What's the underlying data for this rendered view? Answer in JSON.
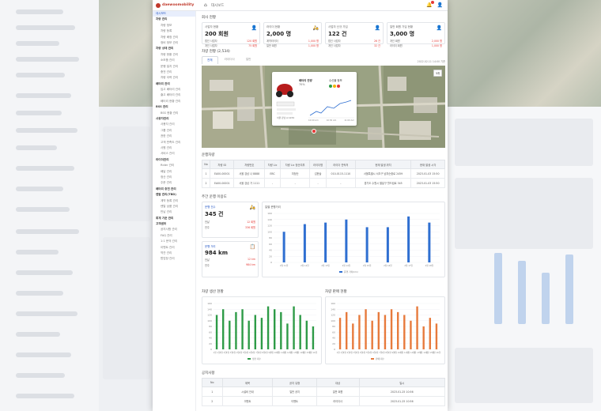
{
  "app": {
    "logo": "daewoomobility",
    "breadcrumb": "대시보드",
    "home_icon": "home-icon",
    "bell_icon": "bell-icon",
    "user_icon": "user-icon",
    "accent_color": "#2457c5",
    "alert_color": "#e53935"
  },
  "sidebar": {
    "items": [
      {
        "label": "대시보드",
        "type": "active"
      },
      {
        "label": "차량 관리",
        "type": "grp"
      },
      {
        "label": "차량 정보",
        "type": "sub"
      },
      {
        "label": "차량 등록",
        "type": "sub"
      },
      {
        "label": "차량 배정 관리",
        "type": "sub"
      },
      {
        "label": "정비 정보 관리",
        "type": "sub"
      },
      {
        "label": "차량 상태 관리",
        "type": "grp"
      },
      {
        "label": "차량 현황 관리",
        "type": "sub"
      },
      {
        "label": "소모품 관리",
        "type": "sub"
      },
      {
        "label": "운행 일지 관리",
        "type": "sub"
      },
      {
        "label": "충전 관리",
        "type": "sub"
      },
      {
        "label": "차량 이력 관리",
        "type": "sub"
      },
      {
        "label": "배터리 관리",
        "type": "grp"
      },
      {
        "label": "입고 배터리 관리",
        "type": "sub"
      },
      {
        "label": "출고 배터리 관리",
        "type": "sub"
      },
      {
        "label": "배터리 현황 관리",
        "type": "sub"
      },
      {
        "label": "BSS 관리",
        "type": "grp"
      },
      {
        "label": "BSS 현황 관리",
        "type": "sub"
      },
      {
        "label": "사용자관리",
        "type": "grp"
      },
      {
        "label": "사용자 관리",
        "type": "sub"
      },
      {
        "label": "그룹 관리",
        "type": "sub"
      },
      {
        "label": "권한 관리",
        "type": "sub"
      },
      {
        "label": "고객 만족도 관리",
        "type": "sub"
      },
      {
        "label": "사원 관리",
        "type": "sub"
      },
      {
        "label": "서비스 관리",
        "type": "sub"
      },
      {
        "label": "라이더관리",
        "type": "grp"
      },
      {
        "label": "Rider 관리",
        "type": "sub"
      },
      {
        "label": "배달 관리",
        "type": "sub"
      },
      {
        "label": "정산 관리",
        "type": "sub"
      },
      {
        "label": "주문 관리",
        "type": "sub"
      },
      {
        "label": "배터리 충전 관리",
        "type": "grp"
      },
      {
        "label": "렌탈 관리(TBD)",
        "type": "grp"
      },
      {
        "label": "계약 등록 관리",
        "type": "sub"
      },
      {
        "label": "렌탈 상품 관리",
        "type": "sub"
      },
      {
        "label": "반납 관리",
        "type": "sub"
      },
      {
        "label": "회계 기준 관리",
        "type": "grp"
      },
      {
        "label": "고객센터",
        "type": "grp"
      },
      {
        "label": "공지사항 관리",
        "type": "sub"
      },
      {
        "label": "FAQ 관리",
        "type": "sub"
      },
      {
        "label": "1:1 문의 관리",
        "type": "sub"
      },
      {
        "label": "이벤트 관리",
        "type": "sub"
      },
      {
        "label": "약관 관리",
        "type": "sub"
      },
      {
        "label": "팝업창 관리",
        "type": "sub"
      }
    ]
  },
  "overview": {
    "section_title": "회사 현황",
    "cards": [
      {
        "label": "사업자 현황",
        "value": "200 회원",
        "icon": "user-icon",
        "rows": [
          [
            "법인 사업자",
            "120 회원"
          ],
          [
            "개인 사업자",
            "75 회원"
          ]
        ]
      },
      {
        "label": "라이더 현황",
        "value": "2,000 명",
        "icon": "rider-icon",
        "rows": [
          [
            "계약라이더",
            "1,000 명"
          ],
          [
            "일반 회원",
            "1,000 명"
          ]
        ]
      },
      {
        "label": "사업자 신규 가입",
        "value": "122 건",
        "icon": "signup-icon",
        "rows": [
          [
            "법인 사업자",
            "26 건"
          ],
          [
            "개인 사업자",
            "32 건"
          ]
        ]
      },
      {
        "label": "일반 회원 가입 현황",
        "value": "3,000 명",
        "icon": "member-icon",
        "rows": [
          [
            "개인 회원",
            "2,000 명"
          ],
          [
            "라이더 회원",
            "1,000 명"
          ]
        ]
      }
    ]
  },
  "vehicle": {
    "section_title": "차량 현황 (2,534)",
    "tabs": [
      "전체",
      "라이더사",
      "일반"
    ],
    "timestamp": "2022.02.11 14:00 기준",
    "map_button": "3개",
    "popup": {
      "battery_label": "배터리 잔량",
      "battery_value": "70%",
      "voltage_label": "수신율 정보",
      "plate": "서울 강남 A 1234",
      "time_labels": [
        "10:00 Am",
        "10:30 Am",
        "11:00 Am"
      ]
    }
  },
  "realtime": {
    "section_title": "운행차량",
    "headers": [
      "No",
      "차량 ID",
      "차량번호",
      "차량 Lic",
      "차량 Lic 정산여부",
      "라이더명",
      "라이더 연락처",
      "현재 발생 위치",
      "현재 발생 시각"
    ],
    "rows": [
      [
        "1",
        "EA00-00001",
        "서울 강남 나 8888",
        "EBC",
        "미정산",
        "김한솔",
        "010-0115-1110",
        "서울특별시 서초구 남부순환로 2459",
        "2023-01-03 15:50"
      ],
      [
        "2",
        "EA00-00001",
        "서울 강남 가 1111",
        "-",
        "-",
        "-",
        "-",
        "경기도 수원시 팔달구 월드컵로 345",
        "2023-01-03 15:50"
      ]
    ]
  },
  "weekly": {
    "section_title": "주간 운행 이용도",
    "cards": [
      {
        "label": "운행 건수",
        "value": "345 건",
        "icon": "scooter-icon",
        "rows": [
          [
            "전날",
            "12 회원"
          ],
          [
            "전주",
            "336 회원"
          ]
        ]
      },
      {
        "label": "운행 거리",
        "value": "984 km",
        "icon": "distance-icon",
        "rows": [
          [
            "전날",
            "12 km"
          ],
          [
            "전주",
            "984 km"
          ]
        ]
      }
    ]
  },
  "chart_data": [
    {
      "type": "bar",
      "title": "일별 운행거리",
      "categories": [
        "2월 11일",
        "2월 12일",
        "2월 13일",
        "2월 14일",
        "2월 15일",
        "2월 16일",
        "2월 17일",
        "2월 18일"
      ],
      "series": [
        {
          "name": "운행 거리(km)",
          "values": [
            100,
            125,
            130,
            140,
            115,
            115,
            150,
            130
          ],
          "color": "#2f6fd1"
        }
      ],
      "ylim": [
        0,
        160
      ],
      "yticks": [
        0,
        20,
        40,
        60,
        80,
        100,
        120,
        140,
        160
      ],
      "legend": "bottom"
    },
    {
      "type": "bar",
      "title": "차량 생산 현황",
      "categories": [
        "1월 1일",
        "1월 2일",
        "1월 3일",
        "1월 4일",
        "1월 5일",
        "1월 6일",
        "1월 7일",
        "1월 8일",
        "1월 9일",
        "1월 10일",
        "1월 11일",
        "1월 12일",
        "1월 13일",
        "1월 14일",
        "1월 15일",
        "1월 16일"
      ],
      "series": [
        {
          "name": "생산 대수",
          "values": [
            120,
            140,
            100,
            130,
            140,
            100,
            120,
            110,
            150,
            140,
            130,
            90,
            150,
            120,
            100,
            80
          ],
          "color": "#2e9b47"
        }
      ],
      "ylim": [
        0,
        160
      ],
      "yticks": [
        0,
        20,
        40,
        60,
        80,
        100,
        120,
        140,
        160
      ],
      "legend": "bottom"
    },
    {
      "type": "bar",
      "title": "차량 판매 현황",
      "categories": [
        "1월 1일",
        "1월 2일",
        "1월 3일",
        "1월 4일",
        "1월 5일",
        "1월 6일",
        "1월 7일",
        "1월 8일",
        "1월 9일",
        "1월 10일",
        "1월 11일",
        "1월 12일",
        "1월 13일",
        "1월 14일",
        "1월 15일",
        "1월 16일"
      ],
      "series": [
        {
          "name": "판매 대수",
          "values": [
            110,
            130,
            90,
            120,
            140,
            100,
            130,
            120,
            140,
            130,
            120,
            100,
            150,
            80,
            110,
            90
          ],
          "color": "#e77a3c"
        }
      ],
      "ylim": [
        0,
        160
      ],
      "yticks": [
        0,
        20,
        40,
        60,
        80,
        100,
        120,
        140,
        160
      ],
      "legend": "bottom"
    }
  ],
  "notices": {
    "section_title": "공지사항",
    "headers": [
      "No",
      "제목",
      "공지 유형",
      "대상",
      "일시"
    ],
    "rows": [
      [
        "1",
        "시설비 안내",
        "일반 공지",
        "일반 회원",
        "2023-01-25 10:56"
      ],
      [
        "2",
        "이벤트",
        "이벤트",
        "라이더사",
        "2023-01-25 10:56"
      ]
    ]
  }
}
